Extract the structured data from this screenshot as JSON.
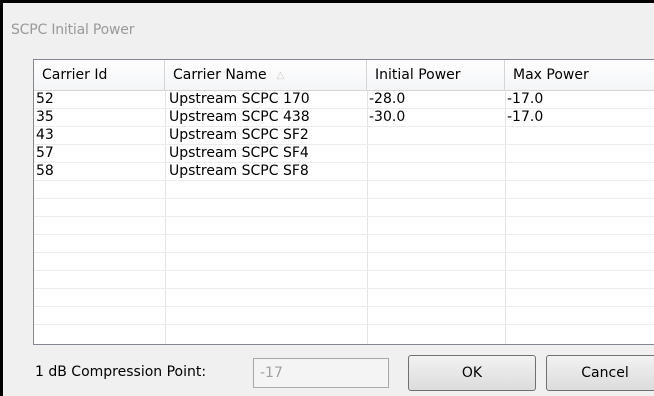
{
  "window": {
    "title": "SCPC Initial Power"
  },
  "grid": {
    "columns": [
      "Carrier Id",
      "Carrier Name",
      "Initial Power",
      "Max Power"
    ],
    "rows": [
      [
        "52",
        "Upstream SCPC 170",
        "-28.0",
        "-17.0"
      ],
      [
        "35",
        "Upstream SCPC 438",
        "-30.0",
        "-17.0"
      ],
      [
        "43",
        "Upstream SCPC SF2",
        "",
        ""
      ],
      [
        "57",
        "Upstream SCPC SF4",
        "",
        ""
      ],
      [
        "58",
        "Upstream SCPC SF8",
        "",
        ""
      ],
      [
        "",
        "",
        "",
        ""
      ],
      [
        "",
        "",
        "",
        ""
      ],
      [
        "",
        "",
        "",
        ""
      ],
      [
        "",
        "",
        "",
        ""
      ],
      [
        "",
        "",
        "",
        ""
      ],
      [
        "",
        "",
        "",
        ""
      ],
      [
        "",
        "",
        "",
        ""
      ],
      [
        "",
        "",
        "",
        ""
      ]
    ],
    "sort_icon": "sort-ascending-icon"
  },
  "compression": {
    "label": "1 dB Compression Point:",
    "value": "-17"
  },
  "buttons": {
    "ok": "OK",
    "cancel": "Cancel"
  }
}
